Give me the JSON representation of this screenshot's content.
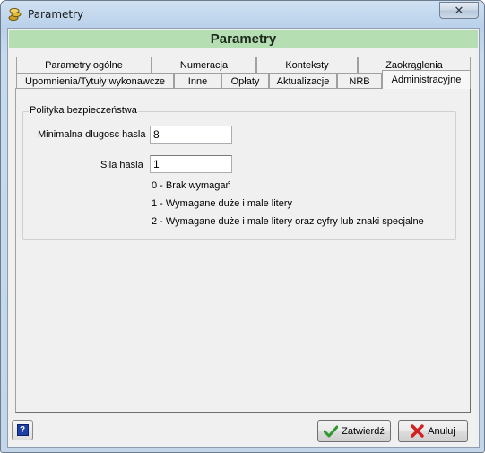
{
  "window": {
    "title": "Parametry",
    "close_symbol": "✕"
  },
  "header": {
    "title": "Parametry"
  },
  "tabs": {
    "row1": [
      {
        "label": "Parametry ogólne"
      },
      {
        "label": "Numeracja"
      },
      {
        "label": "Konteksty"
      },
      {
        "label": "Zaokrąglenia"
      }
    ],
    "row2": [
      {
        "label": "Upomnienia/Tytuły wykonawcze"
      },
      {
        "label": "Inne"
      },
      {
        "label": "Opłaty"
      },
      {
        "label": "Aktualizacje"
      },
      {
        "label": "NRB"
      },
      {
        "label": "Administracyjne",
        "active": true
      }
    ]
  },
  "security": {
    "group_title": "Polityka bezpieczeństwa",
    "min_length_label": "Minimalna dlugosc hasla",
    "min_length_value": "8",
    "strength_label": "Sila hasla",
    "strength_value": "1",
    "levels": [
      "0 - Brak wymagań",
      "1 - Wymagane duże i male litery",
      "2 - Wymagane duże i male litery oraz cyfry lub znaki specjalne"
    ]
  },
  "footer": {
    "help_symbol": "?",
    "confirm_label": "Zatwierdź",
    "cancel_label": "Anuluj"
  }
}
